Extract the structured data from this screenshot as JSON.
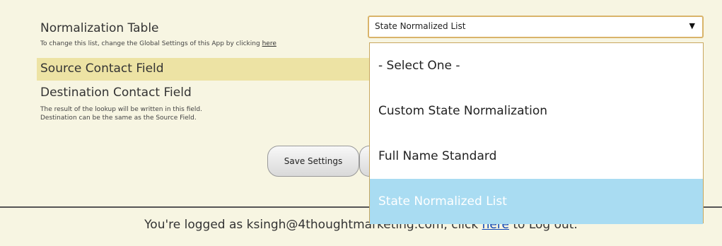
{
  "form": {
    "normalization_table_label": "Normalization Table",
    "normalization_hint": "To change this list, change the Global Settings of this App by clicking",
    "normalization_hint_link": "here",
    "source_contact_field_label": "Source Contact Field",
    "destination_contact_field_label": "Destination Contact Field",
    "destination_hint_line1": "The result of the lookup will be written in this field.",
    "destination_hint_line2": "Destination can be the same as the Source Field.",
    "save_button_label": "Save Settings"
  },
  "select": {
    "selected_value": "State Normalized List",
    "arrow": "▼",
    "options": [
      "- Select One -",
      "Custom State Normalization",
      "Full Name Standard",
      "State Normalized List"
    ],
    "selected_index": 3
  },
  "footer": {
    "text_before": "You're logged as ksingh@4thoughtmarketing.com, click",
    "link_text": "here",
    "text_after": "to Log out."
  },
  "colors": {
    "panel_bg": "#f7f5e2",
    "highlight_row": "#ede3a4",
    "selected_option_bg": "#a9dcf2",
    "select_border": "#d9b46a",
    "link": "#0b44b4"
  }
}
